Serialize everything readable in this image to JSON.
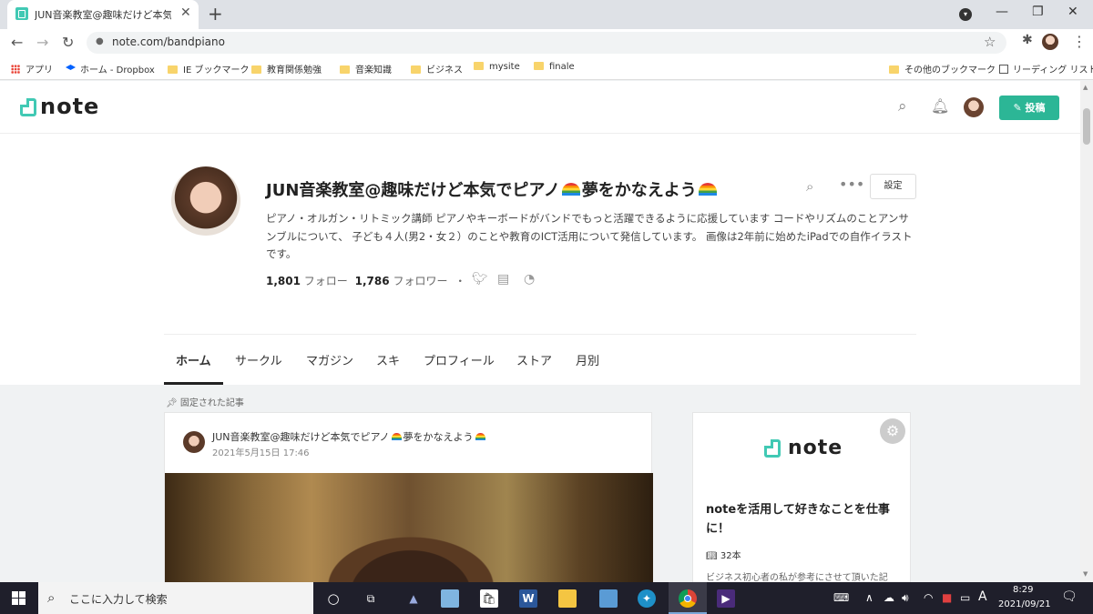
{
  "browser": {
    "tab_title": "JUN音楽教室@趣味だけど本気でピアノ",
    "url": "note.com/bandpiano",
    "bookmarks": [
      "アプリ",
      "ホーム - Dropbox",
      "IE ブックマーク",
      "教育関係勉強",
      "音楽知識",
      "ビジネス",
      "mysite",
      "finale"
    ],
    "other_bookmarks": "その他のブックマーク",
    "reading_list": "リーディング リスト"
  },
  "header": {
    "logo": "note",
    "post_button": "投稿"
  },
  "profile": {
    "name_prefix": "JUN音楽教室@趣味だけど本気でピアノ",
    "name_mid": "夢をかなえよう",
    "settings_button": "設定",
    "bio": "ピアノ・オルガン・リトミック講師 ピアノやキーボードがバンドでもっと活躍できるように応援しています コードやリズムのことアンサンブルについて、 子ども４人(男2・女２）のことや教育のICT活用について発信しています。 画像は2年前に始めたiPadでの自作イラストです。",
    "follow_count": "1,801",
    "follow_label": "フォロー",
    "follower_count": "1,786",
    "follower_label": "フォロワー",
    "dot": "・"
  },
  "tabs": [
    "ホーム",
    "サークル",
    "マガジン",
    "スキ",
    "プロフィール",
    "ストア",
    "月別"
  ],
  "pinned": {
    "label": "固定された記事",
    "author_prefix": "JUN音楽教室@趣味だけど本気でピアノ",
    "author_mid": "夢をかなえよう",
    "date": "2021年5月15日 17:46"
  },
  "sidebar": {
    "logo": "note",
    "title": "noteを活用して好きなことを仕事に！",
    "count": "32本",
    "desc": "ビジネス初心者の私が参考にさせて頂いた記"
  },
  "taskbar": {
    "search_placeholder": "ここに入力して検索",
    "ime": "A",
    "time": "8:29",
    "date": "2021/09/21"
  }
}
